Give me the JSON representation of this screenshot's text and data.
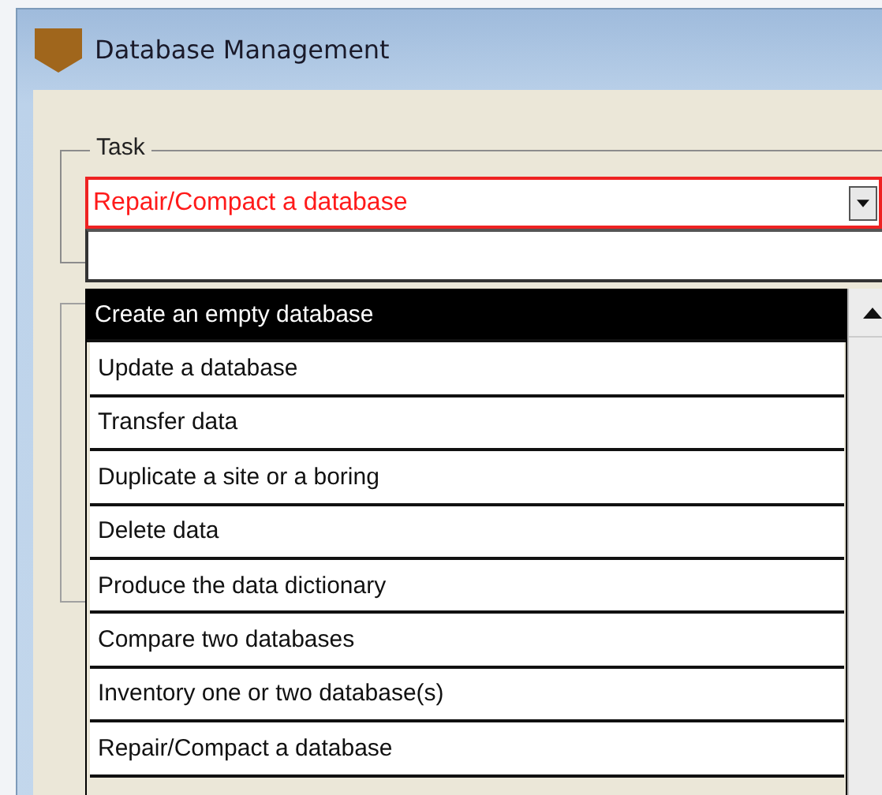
{
  "window": {
    "title": "Database Management"
  },
  "task_group": {
    "label": "Task",
    "combo": {
      "value": "Repair/Compact a database",
      "error": true
    }
  },
  "dropdown": {
    "items": [
      {
        "label": "Create an empty database",
        "selected": true
      },
      {
        "label": "Update a database",
        "selected": false
      },
      {
        "label": "Transfer data",
        "selected": false
      },
      {
        "label": "Duplicate a site or a boring",
        "selected": false
      },
      {
        "label": "Delete data",
        "selected": false
      },
      {
        "label": "Produce the data dictionary",
        "selected": false
      },
      {
        "label": "Compare two databases",
        "selected": false
      },
      {
        "label": "Inventory one or two database(s)",
        "selected": false
      },
      {
        "label": "Repair/Compact a database",
        "selected": false
      }
    ]
  }
}
